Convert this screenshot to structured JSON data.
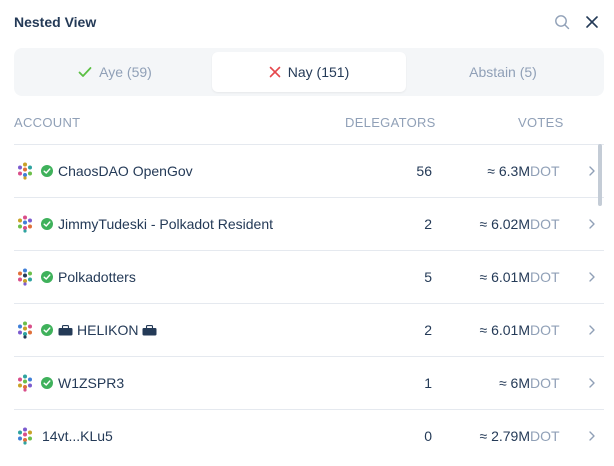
{
  "header": {
    "title": "Nested View"
  },
  "tabs": [
    {
      "label": "Aye (59)",
      "icon": "check-icon",
      "color": "#5bc044"
    },
    {
      "label": "Nay (151)",
      "icon": "x-icon",
      "color": "#e5484d",
      "active": true
    },
    {
      "label": "Abstain (5)"
    }
  ],
  "columns": {
    "account": "ACCOUNT",
    "delegators": "DELEGATORS",
    "votes": "VOTES"
  },
  "rows": [
    {
      "name": "ChaosDAO OpenGov",
      "verified": true,
      "delegators": "56",
      "votes": "≈ 6.3M",
      "unit": "DOT"
    },
    {
      "name": "JimmyTudeski - Polkadot Resident",
      "verified": true,
      "delegators": "2",
      "votes": "≈ 6.02M",
      "unit": "DOT"
    },
    {
      "name": "Polkadotters",
      "verified": true,
      "delegators": "5",
      "votes": "≈ 6.01M",
      "unit": "DOT"
    },
    {
      "name": "HELIKON",
      "verified": true,
      "delegators": "2",
      "votes": "≈ 6.01M",
      "unit": "DOT"
    },
    {
      "name": "W1ZSPR3",
      "verified": true,
      "delegators": "1",
      "votes": "≈ 6M",
      "unit": "DOT"
    },
    {
      "name": "14vt...KLu5",
      "verified": false,
      "delegators": "0",
      "votes": "≈ 2.79M",
      "unit": "DOT"
    }
  ],
  "colors": {
    "text": "#243a57",
    "muted": "#90a0b7",
    "verified": "#3fb15b",
    "aye": "#5bc044",
    "nay": "#e5484d"
  }
}
